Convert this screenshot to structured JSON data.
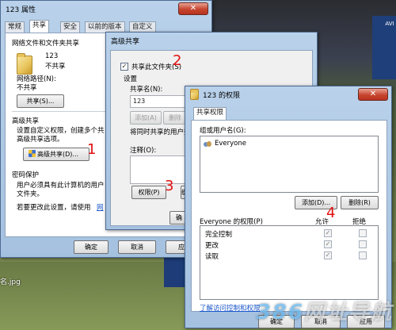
{
  "background": {
    "file_label": "名.jpg",
    "watermark_digits": "386",
    "watermark_text": "网址导航",
    "logo_text": "AVI"
  },
  "props": {
    "title": "123 属性",
    "close": "✕",
    "tabs": [
      "常规",
      "共享",
      "安全",
      "以前的版本",
      "自定义"
    ],
    "group1_title": "网络文件和文件夹共享",
    "folder_name": "123",
    "folder_status": "不共享",
    "net_path_label": "网络路径(N):",
    "net_path_value": "不共享",
    "share_button": "共享(S)...",
    "adv_title": "高级共享",
    "adv_desc1": "设置自定义权限，创建多个共",
    "adv_desc2": "高级共享选项。",
    "adv_button": "高级共享(D)...",
    "pw_title": "密码保护",
    "pw_desc1": "用户必须具有此计算机的用户",
    "pw_desc2": "文件夹。",
    "pw_desc3": "若要更改此设置，请使用",
    "pw_link": "网",
    "ok": "确定",
    "cancel": "取消",
    "apply": "应用"
  },
  "adv": {
    "title": "高级共享",
    "share_checkbox": "共享此文件夹(S)",
    "settings_label": "设置",
    "share_name_label": "共享名(N):",
    "share_name_value": "123",
    "add_button": "添加(A)",
    "remove_button": "删除",
    "limit_label": "将同时共享的用户数",
    "comment_label": "注释(O):",
    "perm_button": "权限(P)",
    "cache_button": "缓",
    "ok_partial": "确"
  },
  "perm": {
    "title": "123 的权限",
    "close": "✕",
    "tab": "共享权限",
    "group_label": "组或用户名(G):",
    "users": [
      "Everyone"
    ],
    "add_button": "添加(D)...",
    "remove_button": "删除(R)",
    "perm_for_label": "Everyone 的权限(P)",
    "allow_header": "允许",
    "deny_header": "拒绝",
    "rows": [
      {
        "name": "完全控制",
        "allow": "✓",
        "deny": ""
      },
      {
        "name": "更改",
        "allow": "✓",
        "deny": ""
      },
      {
        "name": "读取",
        "allow": "✓",
        "deny": ""
      }
    ],
    "learn_link": "了解访问控制和权限",
    "ok": "确定",
    "cancel": "取消",
    "apply": "应用"
  },
  "annotations": [
    "1",
    "2",
    "3",
    "4"
  ]
}
